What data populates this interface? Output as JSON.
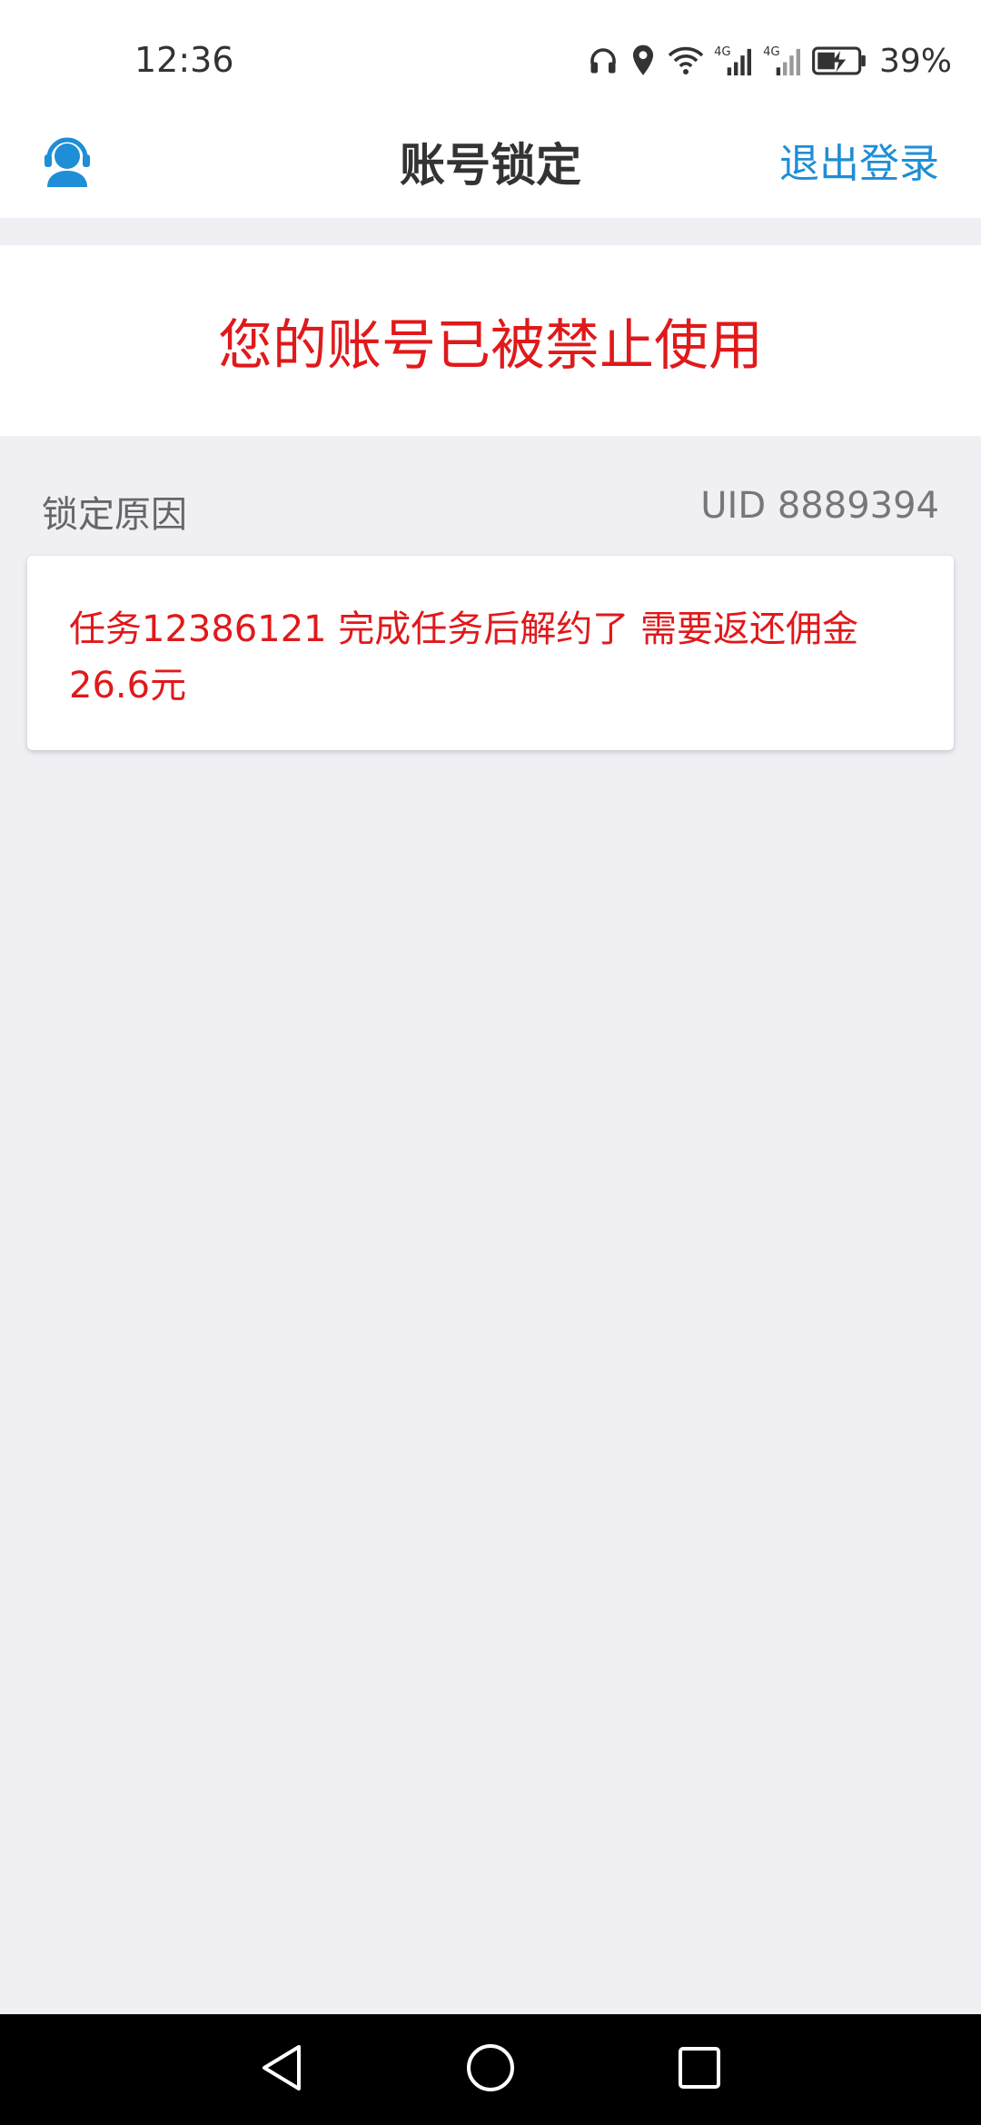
{
  "status_bar": {
    "time": "12:36",
    "battery_percent": "39%",
    "network_labels": [
      "4G",
      "4G"
    ],
    "icons": [
      "headphones-icon",
      "location-icon",
      "wifi-icon",
      "signal-icon",
      "signal-icon",
      "battery-charging-icon"
    ]
  },
  "nav": {
    "title": "账号锁定",
    "logout_label": "退出登录",
    "support_icon": "customer-service-icon"
  },
  "banner": {
    "message": "您的账号已被禁止使用"
  },
  "lock_section": {
    "label": "锁定原因",
    "uid_text": "UID 8889394"
  },
  "reason": {
    "text": "任务12386121 完成任务后解约了 需要返还佣金26.6元"
  },
  "colors": {
    "accent_blue": "#1e8ed6",
    "alert_red": "#e0191b",
    "page_bg": "#efeff4"
  },
  "system_nav": {
    "icons": [
      "back-icon",
      "home-icon",
      "recent-apps-icon"
    ]
  }
}
